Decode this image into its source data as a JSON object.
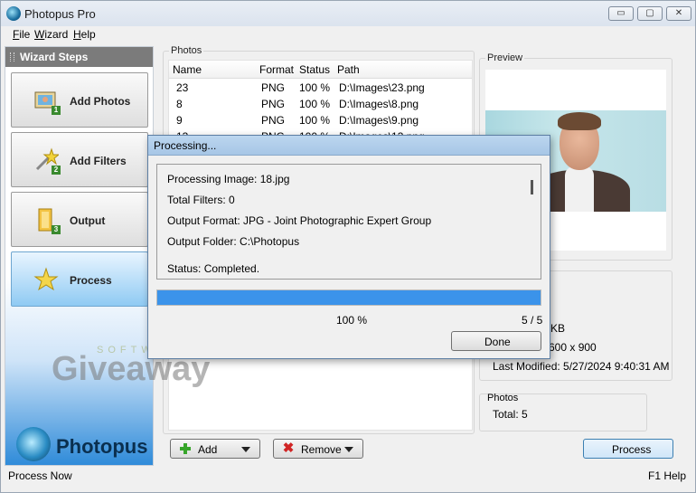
{
  "window": {
    "title": "Photopus Pro",
    "buttons": {
      "minimize": "▭",
      "maximize": "▢",
      "close": "✕"
    }
  },
  "menu": {
    "items": [
      {
        "underline": "F",
        "rest": "ile"
      },
      {
        "underline": "W",
        "rest": "izard"
      },
      {
        "underline": "H",
        "rest": "elp"
      }
    ]
  },
  "sidebar": {
    "header": "Wizard Steps",
    "steps": [
      {
        "label": "Add Photos",
        "badge": "1"
      },
      {
        "label": "Add Filters",
        "badge": "2"
      },
      {
        "label": "Output",
        "badge": "3"
      },
      {
        "label": "Process",
        "badge": ""
      }
    ],
    "logo_text": "Photopus"
  },
  "photos": {
    "group_label": "Photos",
    "columns": [
      "Name",
      "Format",
      "Status",
      "Path"
    ],
    "rows": [
      {
        "name": "23",
        "format": "PNG",
        "status": "100 %",
        "path": "D:\\Images\\23.png"
      },
      {
        "name": "8",
        "format": "PNG",
        "status": "100 %",
        "path": "D:\\Images\\8.png"
      },
      {
        "name": "9",
        "format": "PNG",
        "status": "100 %",
        "path": "D:\\Images\\9.png"
      },
      {
        "name": "13",
        "format": "PNG",
        "status": "100 %",
        "path": "D:\\Images\\13.png"
      }
    ]
  },
  "preview": {
    "group_label": "Preview"
  },
  "info": {
    "size_fragment": "KB",
    "dimensions_fragment": "600 x 900",
    "last_modified": "Last Modified: 5/27/2024 9:40:31 AM"
  },
  "stats": {
    "group_label": "Photos",
    "total": "Total: 5"
  },
  "buttons": {
    "add": "Add",
    "remove": "Remove",
    "process": "Process"
  },
  "status_bar": {
    "left": "Process Now",
    "right": "F1 Help"
  },
  "watermark": {
    "small": "SOFTWARE",
    "big": "Giveaway"
  },
  "dialog": {
    "title": "Processing...",
    "lines": [
      "Processing Image: 18.jpg",
      "Total Filters: 0",
      "Output Format: JPG - Joint Photographic Expert Group",
      "Output Folder: C:\\Photopus",
      "Status: Completed."
    ],
    "progress_fraction": 1.0,
    "percent_text": "100 %",
    "count_text": "5 / 5",
    "done_label": "Done"
  },
  "colors": {
    "progress": "#3b93ea",
    "accent": "#2f8bd9"
  }
}
